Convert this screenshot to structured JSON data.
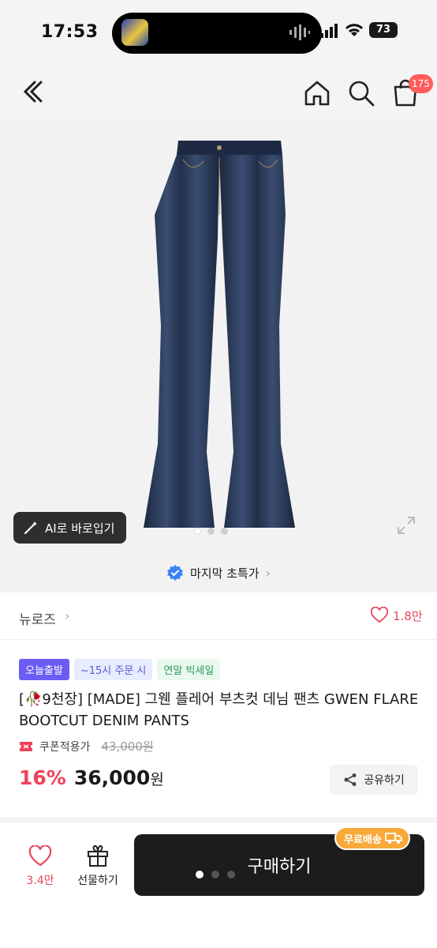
{
  "status": {
    "time": "17:53",
    "extra": "❄",
    "battery": "73"
  },
  "header": {
    "cart_count": "175"
  },
  "image": {
    "ai_button_label": "AI로 바로입기",
    "slide_count": 3,
    "active_slide": 1
  },
  "promo": {
    "label": "마지막 초특가"
  },
  "brand": {
    "name": "뉴로즈",
    "likes": "1.8만"
  },
  "tags": [
    "오늘출발",
    "~15시 주문 시",
    "연말 빅세일"
  ],
  "product": {
    "title": "[🥀9천장] [MADE] 그웬 플레어 부츠컷 데님 팬츠 GWEN FLARE BOOTCUT DENIM PANTS",
    "coupon_label": "쿠폰적용가",
    "original_price": "43,000원",
    "discount": "16%",
    "price": "36,000",
    "price_unit": "원"
  },
  "share": {
    "label": "공유하기"
  },
  "bottom": {
    "like_count": "3.4만",
    "gift_label": "선물하기",
    "buy_label": "구매하기",
    "free_shipping_label": "무료배송"
  },
  "colors": {
    "accent_red": "#f0415a",
    "free_ship": "#f7a93b",
    "today_tag": "#6b5cf4"
  }
}
